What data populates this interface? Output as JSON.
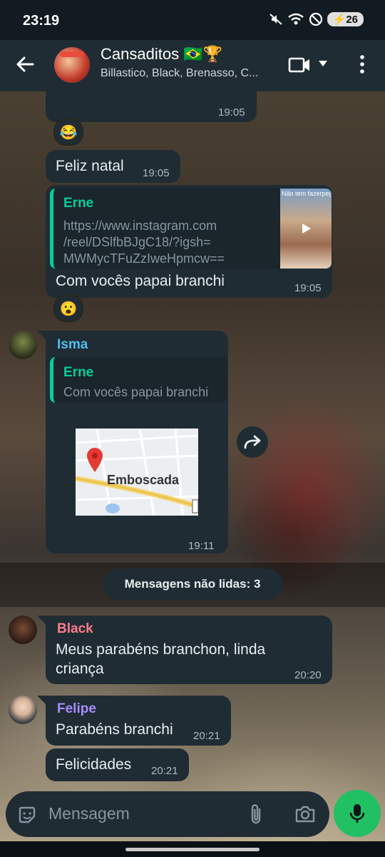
{
  "status_bar": {
    "time": "23:19",
    "battery": "26"
  },
  "header": {
    "title": "Cansaditos 🇧🇷🏆",
    "subtitle": "Billastico, Black, Brenasso, C..."
  },
  "messages": {
    "m1": {
      "time": "19:05",
      "reaction": "😂"
    },
    "m2": {
      "text": "Feliz natal",
      "time": "19:05"
    },
    "m3": {
      "quote_name": "Erne",
      "link_line1": "https://www.instagram.com",
      "link_line2": "/reel/DSlfbBJgC18/?igsh=",
      "link_line3": "MWMycTFuZzIweHpmcw==",
      "thumb_text": "Não tem fazerpepeo...",
      "text": "Com vocês papai branchi",
      "time": "19:05",
      "reaction": "😮"
    },
    "m4": {
      "sender": "Isma",
      "quote_name": "Erne",
      "quote_text": "Com vocês papai branchi",
      "map_label": "Emboscada",
      "time": "19:11"
    }
  },
  "unread_label": "Mensagens não lidas: 3",
  "messages2": {
    "m5": {
      "sender": "Black",
      "line1": "Meus parabéns branchon, linda",
      "line2": "criança",
      "time": "20:20"
    },
    "m6": {
      "sender": "Felipe",
      "text": "Parabéns branchi",
      "time": "20:21"
    },
    "m7": {
      "text": "Felicidades",
      "time": "20:21"
    }
  },
  "input": {
    "placeholder": "Mensagem"
  },
  "colors": {
    "bubble": "#1f2c34",
    "accent_green": "#21c063",
    "quote_green": "#06cf9c",
    "isma_name": "#53bdeb",
    "black_name": "#ff7b8a",
    "felipe_name": "#a78bfa"
  }
}
